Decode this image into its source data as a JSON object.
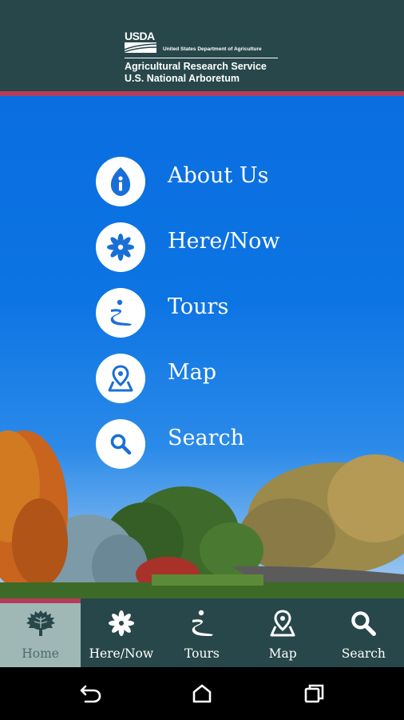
{
  "header": {
    "usda_logo_text": "USDA",
    "department": "United States Department of Agriculture",
    "agency": "Agricultural Research Service",
    "unit": "U.S. National Arboretum"
  },
  "menu": {
    "items": [
      {
        "label": "About Us",
        "icon": "info-leaf-icon"
      },
      {
        "label": "Here/Now",
        "icon": "flower-icon"
      },
      {
        "label": "Tours",
        "icon": "tour-path-icon"
      },
      {
        "label": "Map",
        "icon": "map-pin-icon"
      },
      {
        "label": "Search",
        "icon": "search-icon"
      }
    ]
  },
  "tabbar": {
    "tabs": [
      {
        "label": "Home",
        "icon": "tree-icon",
        "active": true
      },
      {
        "label": "Here/Now",
        "icon": "flower-icon",
        "active": false
      },
      {
        "label": "Tours",
        "icon": "tour-path-icon",
        "active": false
      },
      {
        "label": "Map",
        "icon": "map-pin-icon",
        "active": false
      },
      {
        "label": "Search",
        "icon": "search-icon",
        "active": false
      }
    ]
  },
  "system_nav": {
    "buttons": [
      "back-icon",
      "home-icon",
      "recents-icon"
    ]
  },
  "colors": {
    "header_bg": "#28474a",
    "accent": "#b43c5a",
    "sky_blue": "#0c74e3",
    "icon_blue": "#1a6fd6",
    "active_tab_bg": "#9fb8b5"
  }
}
